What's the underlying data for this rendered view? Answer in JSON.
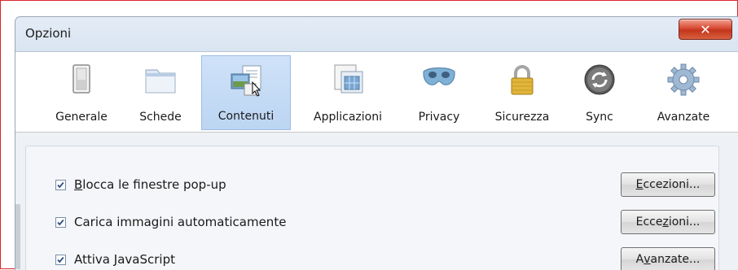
{
  "window": {
    "title": "Opzioni",
    "close_glyph": "✕"
  },
  "toolbar": {
    "items": [
      {
        "label": "Generale",
        "icon": "switch-icon"
      },
      {
        "label": "Schede",
        "icon": "folder-tabs-icon"
      },
      {
        "label": "Contenuti",
        "icon": "content-icon",
        "selected": true
      },
      {
        "label": "Applicazioni",
        "icon": "applications-icon"
      },
      {
        "label": "Privacy",
        "icon": "mask-icon"
      },
      {
        "label": "Sicurezza",
        "icon": "padlock-icon"
      },
      {
        "label": "Sync",
        "icon": "sync-icon"
      },
      {
        "label": "Avanzate",
        "icon": "gear-icon"
      }
    ]
  },
  "content": {
    "rows": [
      {
        "checked": true,
        "label_u": "B",
        "label_rest": "locca le finestre pop-up",
        "button_pre": "",
        "button_u": "E",
        "button_post": "ccezioni..."
      },
      {
        "checked": true,
        "label_u": "",
        "label_rest": "Carica immagini automaticamente",
        "button_pre": "Ecce",
        "button_u": "z",
        "button_post": "ioni..."
      },
      {
        "checked": true,
        "label_pre": "Attiva ",
        "label_u": "J",
        "label_rest": "avaScript",
        "button_pre": "A",
        "button_u": "v",
        "button_post": "anzate..."
      }
    ]
  },
  "colors": {
    "selected_tab": "#c5dbf5",
    "close_button": "#d84a33",
    "outer_border": "#d9262c"
  }
}
